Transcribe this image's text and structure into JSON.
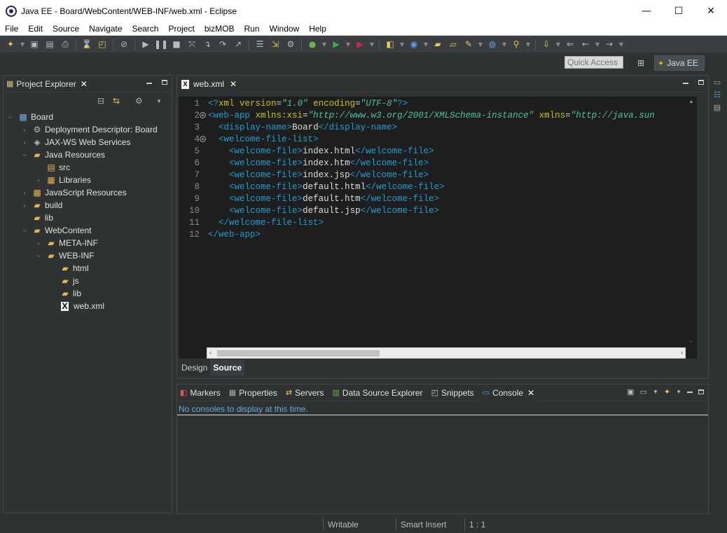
{
  "window": {
    "title": "Java EE - Board/WebContent/WEB-INF/web.xml - Eclipse",
    "minimize": "—",
    "maximize": "☐",
    "close": "✕"
  },
  "menu": [
    "File",
    "Edit",
    "Source",
    "Navigate",
    "Search",
    "Project",
    "bizMOB",
    "Run",
    "Window",
    "Help"
  ],
  "perspective": {
    "quick_access": "Quick Access",
    "active": "Java EE"
  },
  "project_explorer": {
    "title": "Project Explorer",
    "tree": [
      {
        "label": "Board",
        "icon": "project-icon"
      },
      {
        "label": "Deployment Descriptor: Board",
        "icon": "deployment-icon"
      },
      {
        "label": "JAX-WS Web Services",
        "icon": "webservice-icon"
      },
      {
        "label": "Java Resources",
        "icon": "java-resources-icon"
      },
      {
        "label": "src",
        "icon": "package-folder-icon"
      },
      {
        "label": "Libraries",
        "icon": "library-icon"
      },
      {
        "label": "JavaScript Resources",
        "icon": "js-resources-icon"
      },
      {
        "label": "build",
        "icon": "folder-icon"
      },
      {
        "label": "lib",
        "icon": "folder-icon"
      },
      {
        "label": "WebContent",
        "icon": "folder-icon"
      },
      {
        "label": "META-INF",
        "icon": "folder-icon"
      },
      {
        "label": "WEB-INF",
        "icon": "folder-icon"
      },
      {
        "label": "html",
        "icon": "folder-icon"
      },
      {
        "label": "js",
        "icon": "folder-icon"
      },
      {
        "label": "lib",
        "icon": "folder-icon"
      },
      {
        "label": "web.xml",
        "icon": "xml-file-icon"
      }
    ]
  },
  "editor": {
    "tab": "web.xml",
    "line_numbers": [
      "1",
      "2",
      "3",
      "4",
      "5",
      "6",
      "7",
      "8",
      "9",
      "10",
      "11",
      "12"
    ],
    "xml_decl": {
      "open": "<?",
      "name": "xml",
      "a1": "version",
      "v1": "\"1.0\"",
      "a2": "encoding",
      "v2": "\"UTF-8\"",
      "close": "?>"
    },
    "webapp_open": {
      "tag": "web-app",
      "a1": "xmlns:xsi",
      "v1": "\"http://www.w3.org/2001/XMLSchema-instance\"",
      "a2": "xmlns",
      "v2": "\"http://java.sun"
    },
    "display_name": {
      "tag": "display-name",
      "text": "Board"
    },
    "welcome_list_tag": "welcome-file-list",
    "welcome_files": [
      "index.html",
      "index.htm",
      "index.jsp",
      "default.html",
      "default.htm",
      "default.jsp"
    ],
    "welcome_file_tag": "welcome-file",
    "webapp_close": "web-app",
    "bottom_tabs": [
      "Design",
      "Source"
    ]
  },
  "bottom_panel": {
    "tabs": [
      {
        "label": "Markers",
        "icon": "markers-icon"
      },
      {
        "label": "Properties",
        "icon": "properties-icon"
      },
      {
        "label": "Servers",
        "icon": "servers-icon"
      },
      {
        "label": "Data Source Explorer",
        "icon": "datasource-icon"
      },
      {
        "label": "Snippets",
        "icon": "snippets-icon"
      },
      {
        "label": "Console",
        "icon": "console-icon"
      }
    ],
    "console_message": "No consoles to display at this time."
  },
  "status": {
    "mode": "Writable",
    "insert": "Smart Insert",
    "position": "1 : 1"
  }
}
